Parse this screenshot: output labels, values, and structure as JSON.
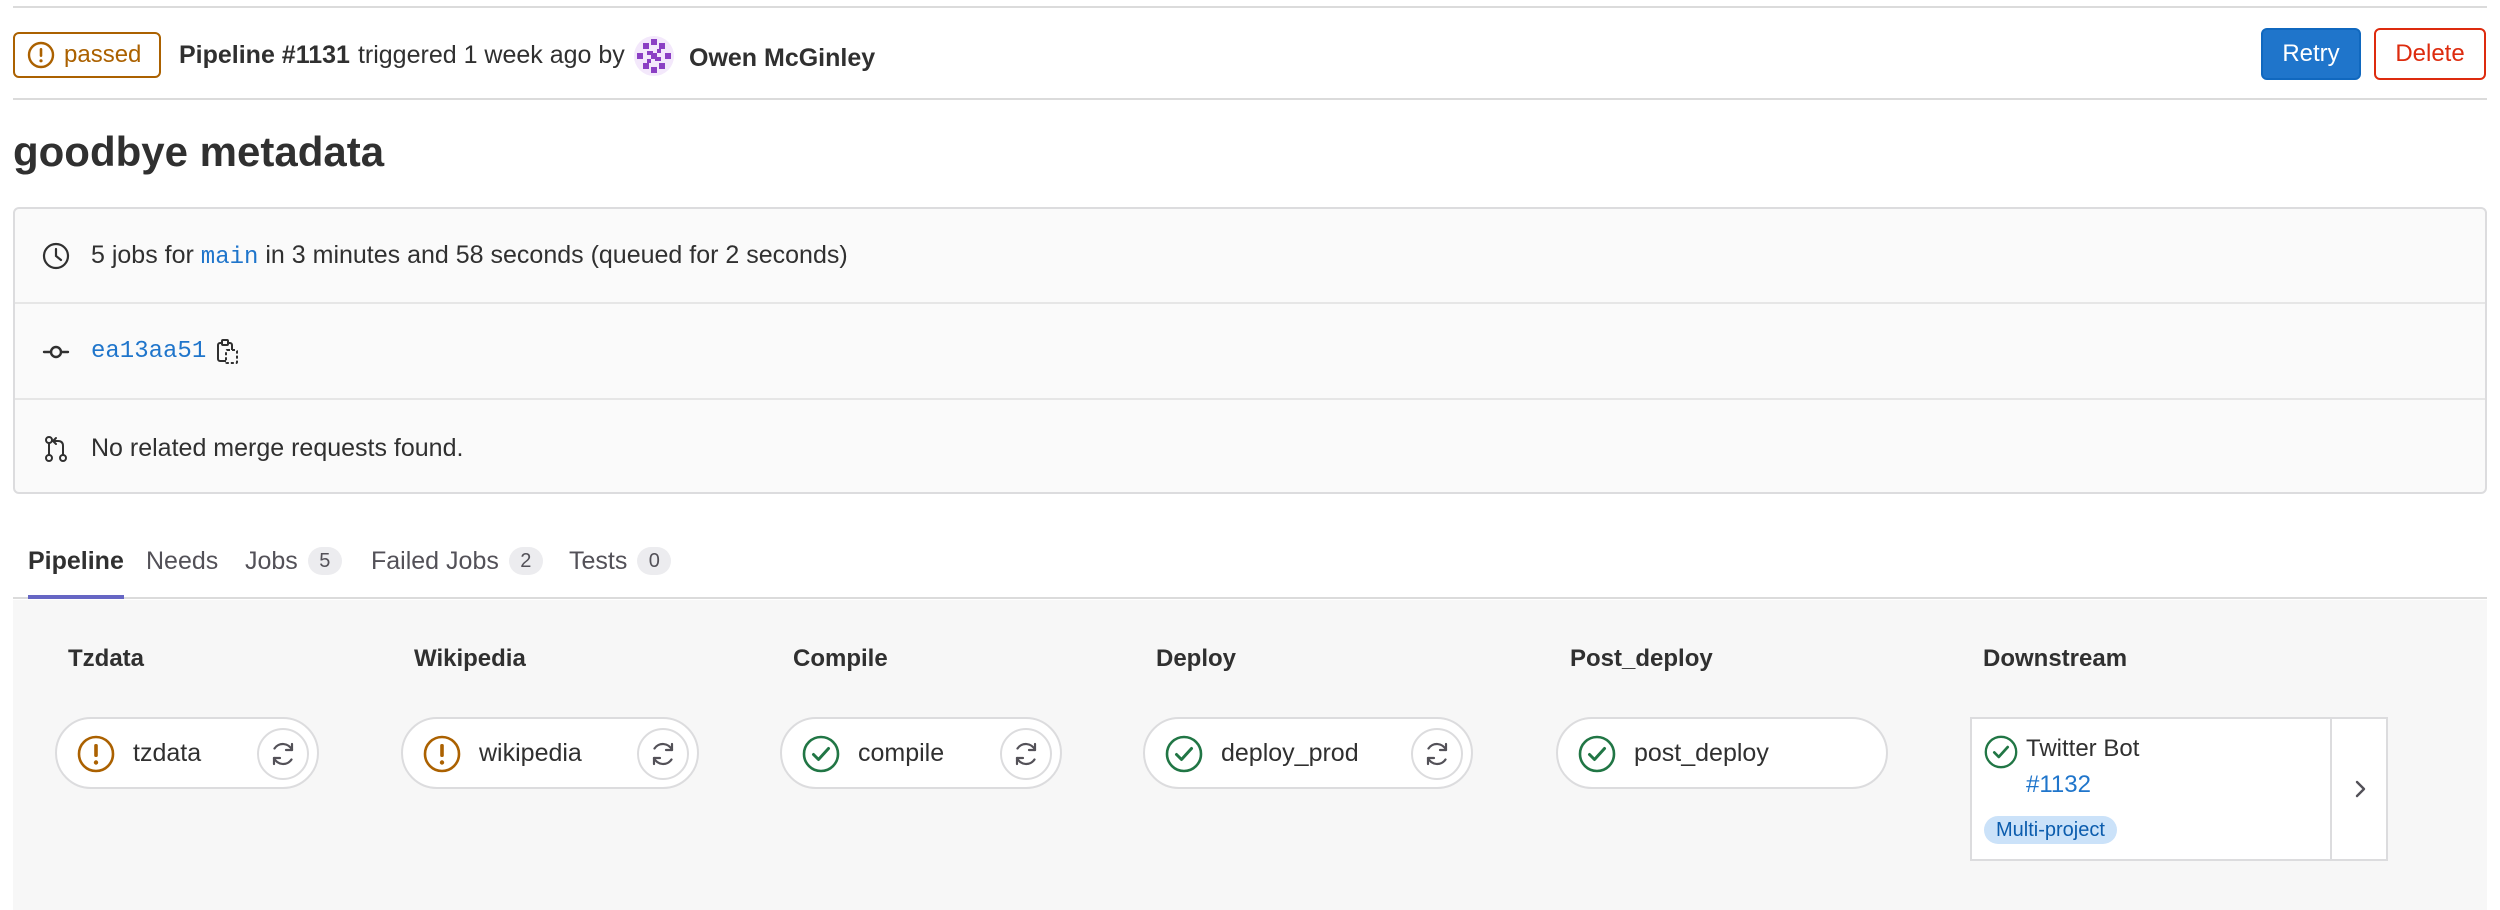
{
  "header": {
    "status_label": "passed",
    "pipeline_label": "Pipeline #1131",
    "triggered_text": "triggered 1 week ago by",
    "author": "Owen McGinley",
    "retry_label": "Retry",
    "delete_label": "Delete"
  },
  "title": "goodbye metadata",
  "info": {
    "jobs_prefix": "5 jobs for",
    "branch": "main",
    "jobs_suffix": "in 3 minutes and 58 seconds (queued for 2 seconds)",
    "commit_sha": "ea13aa51",
    "merge_requests": "No related merge requests found."
  },
  "tabs": [
    {
      "label": "Pipeline",
      "active": true
    },
    {
      "label": "Needs"
    },
    {
      "label": "Jobs",
      "count": "5"
    },
    {
      "label": "Failed Jobs",
      "count": "2"
    },
    {
      "label": "Tests",
      "count": "0"
    }
  ],
  "stages": [
    {
      "title": "Tzdata",
      "job": "tzdata",
      "status": "warning",
      "retry": true
    },
    {
      "title": "Wikipedia",
      "job": "wikipedia",
      "status": "warning",
      "retry": true
    },
    {
      "title": "Compile",
      "job": "compile",
      "status": "success",
      "retry": true
    },
    {
      "title": "Deploy",
      "job": "deploy_prod",
      "status": "success",
      "retry": true
    },
    {
      "title": "Post_deploy",
      "job": "post_deploy",
      "status": "success",
      "retry": false
    },
    {
      "title": "Downstream"
    }
  ],
  "downstream": {
    "project": "Twitter Bot",
    "pipeline_id": "#1132",
    "badge": "Multi-project",
    "status": "success"
  },
  "colors": {
    "warning": "#ab6100",
    "success": "#217645",
    "link": "#1f75cb",
    "danger": "#dd2b0e",
    "active_tab": "#6666c4"
  }
}
